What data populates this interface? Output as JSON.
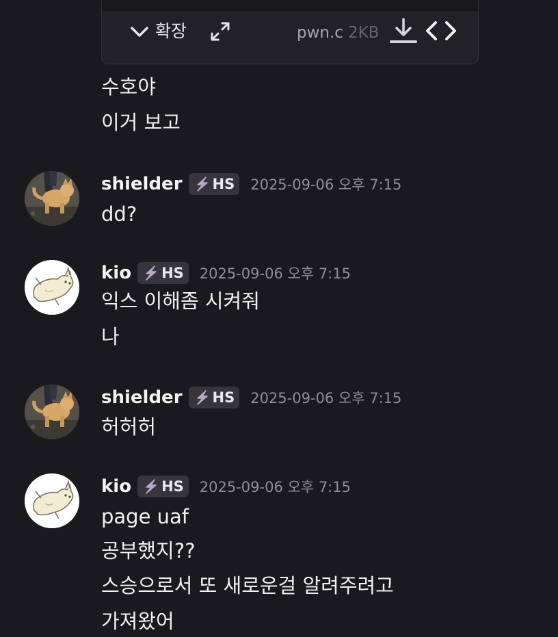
{
  "attachment": {
    "expand_label": "확장",
    "file_name": "pwn.c",
    "file_size": "2KB"
  },
  "messages": [
    {
      "lines": [
        "수호야",
        "이거 보고"
      ]
    },
    {
      "username": "shielder",
      "tag": "HS",
      "timestamp": "2025-09-06 오후 7:15",
      "lines": [
        "dd?"
      ]
    },
    {
      "username": "kio",
      "tag": "HS",
      "timestamp": "2025-09-06 오후 7:15",
      "lines": [
        "익스 이해좀 시켜줘",
        "나"
      ]
    },
    {
      "username": "shielder",
      "tag": "HS",
      "timestamp": "2025-09-06 오후 7:15",
      "lines": [
        "허허허"
      ]
    },
    {
      "username": "kio",
      "tag": "HS",
      "timestamp": "2025-09-06 오후 7:15",
      "lines": [
        "page uaf",
        "공부했지??",
        "스승으로서 또 새로운걸 알려주려고",
        "가져왔어"
      ]
    }
  ],
  "icons": {
    "expand": "chevron-down-icon",
    "fullscreen": "expand-arrows-icon",
    "download": "download-icon",
    "code": "code-brackets-icon",
    "tag": "lightning-icon"
  },
  "colors": {
    "background": "#1a1a1e",
    "tag_background": "#35353b",
    "tag_icon": "#b9a6c9"
  }
}
